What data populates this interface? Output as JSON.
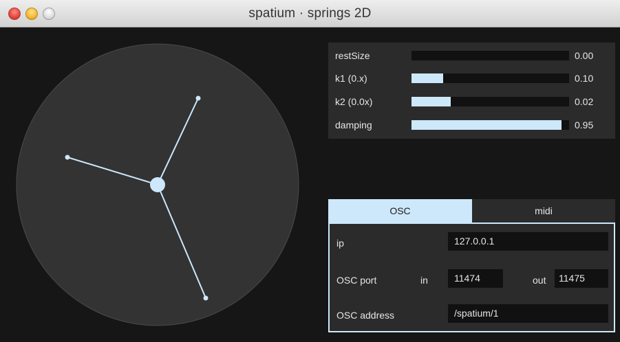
{
  "window": {
    "title": "spatium · springs 2D"
  },
  "colors": {
    "accent": "#cde8fb",
    "panel": "#2b2b2b",
    "background": "#161616",
    "circle": "#333333"
  },
  "sliders": [
    {
      "label": "restSize",
      "value": "0.00",
      "fill": 0.0
    },
    {
      "label": "k1 (0.x)",
      "value": "0.10",
      "fill": 0.2
    },
    {
      "label": "k2 (0.0x)",
      "value": "0.02",
      "fill": 0.25
    },
    {
      "label": "damping",
      "value": "0.95",
      "fill": 0.95
    }
  ],
  "tabs": [
    {
      "label": "OSC",
      "selected": true
    },
    {
      "label": "midi",
      "selected": false
    }
  ],
  "osc": {
    "ip_label": "ip",
    "ip_value": "127.0.0.1",
    "port_label": "OSC port",
    "in_label": "in",
    "in_value": "11474",
    "out_label": "out",
    "out_value": "11475",
    "address_label": "OSC address",
    "address_value": "/spatium/1"
  }
}
